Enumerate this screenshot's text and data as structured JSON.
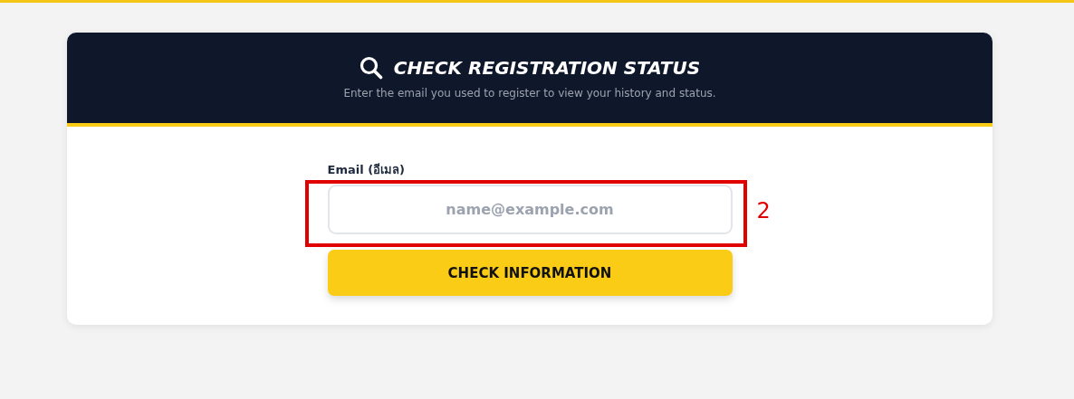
{
  "header": {
    "title": "CHECK REGISTRATION STATUS",
    "subtitle": "Enter the email you used to register to view your history and status."
  },
  "form": {
    "label": "Email (อีเมล)",
    "placeholder": "name@example.com",
    "button": "CHECK INFORMATION"
  },
  "annotation": {
    "label": "2"
  }
}
